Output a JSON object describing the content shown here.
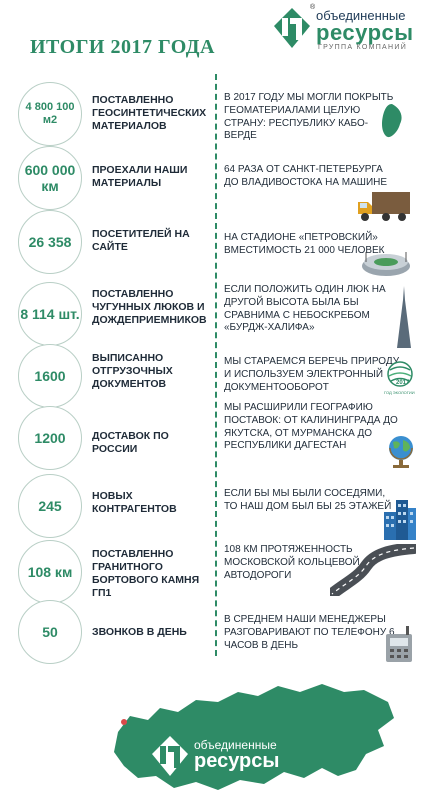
{
  "header": {
    "logo_top": "объединенные",
    "logo_main": "ресурсы",
    "logo_sub": "группа компаний",
    "logo_reg": "®",
    "title": "ИТОГИ 2017 ГОДА"
  },
  "colors": {
    "accent": "#2e8b66",
    "text": "#1f2b38",
    "circle_border": "#b9cfc6"
  },
  "rows": [
    {
      "value": "4 800 100 м2",
      "label": "ПОСТАВЛЕННО ГЕОСИНТЕТИЧЕСКИХ МАТЕРИАЛОВ",
      "fact": "В 2017 ГОДУ МЫ МОГЛИ ПОКРЫТЬ ГЕОМАТЕРИАЛАМИ ЦЕЛУЮ СТРАНУ: РЕСПУБЛИКУ КАБО-ВЕРДЕ",
      "icon": "island-map-icon"
    },
    {
      "value": "600 000 км",
      "label": "ПРОЕХАЛИ НАШИ МАТЕРИАЛЫ",
      "fact": "64 РАЗА ОТ САНКТ-ПЕТЕРБУРГА ДО ВЛАДИВОСТОКА НА МАШИНЕ",
      "icon": "truck-icon"
    },
    {
      "value": "26 358",
      "label": "ПОСЕТИТЕЛЕЙ НА САЙТЕ",
      "fact": "НА СТАДИОНЕ «ПЕТРОВСКИЙ» ВМЕСТИМОСТЬ 21 000 ЧЕЛОВЕК",
      "icon": "stadium-icon"
    },
    {
      "value": "8 114 шт.",
      "label": "ПОСТАВЛЕННО ЧУГУННЫХ ЛЮКОВ И ДОЖДЕПРИЕМНИКОВ",
      "fact": "ЕСЛИ ПОЛОЖИТЬ ОДИН ЛЮК НА ДРУГОЙ ВЫСОТА БЫЛА БЫ СРАВНИМА С НЕБОСКРЕБОМ «БУРДЖ-ХАЛИФА»",
      "icon": "skyscraper-icon"
    },
    {
      "value": "1600",
      "label": "ВЫПИСАННО ОТГРУЗОЧНЫХ ДОКУМЕНТОВ",
      "fact": "МЫ СТАРАЕМСЯ БЕРЕЧЬ ПРИРОДУ И ИСПОЛЬЗУЕМ ЭЛЕКТРОННЫЙ ДОКУМЕНТООБОРОТ",
      "icon": "eco-year-icon",
      "icon_text": "2017",
      "icon_caption": "ГОД ЭКОЛОГИИ"
    },
    {
      "value": "1200",
      "label": "ДОСТАВОК ПО РОССИИ",
      "fact": "МЫ РАСШИРИЛИ ГЕОГРАФИЮ ПОСТАВОК: ОТ КАЛИНИНГРАДА ДО ЯКУТСКА, ОТ МУРМАНСКА ДО РЕСПУБЛИКИ ДАГЕСТАН",
      "icon": "globe-icon"
    },
    {
      "value": "245",
      "label": "НОВЫХ КОНТРАГЕНТОВ",
      "fact": "ЕСЛИ БЫ МЫ БЫЛИ СОСЕДЯМИ, ТО НАШ ДОМ БЫЛ БЫ 25 ЭТАЖЕЙ",
      "icon": "buildings-icon"
    },
    {
      "value": "108 км",
      "label": "ПОСТАВЛЕННО ГРАНИТНОГО БОРТОВОГО КАМНЯ ГП1",
      "fact": "108 КМ ПРОТЯЖЕННОСТЬ МОСКОВСКОЙ КОЛЬЦЕВОЙ АВТОДОРОГИ",
      "icon": "road-icon"
    },
    {
      "value": "50",
      "label": "ЗВОНКОВ В ДЕНЬ",
      "fact": "В СРЕДНЕМ НАШИ МЕНЕДЖЕРЫ РАЗГОВАРИВАЮТ ПО ТЕЛЕФОНУ 6 ЧАСОВ В ДЕНЬ",
      "icon": "phone-icon"
    }
  ],
  "footer": {
    "logo_top": "объединенные",
    "logo_main": "ресурсы",
    "icon": "russia-map-icon"
  }
}
